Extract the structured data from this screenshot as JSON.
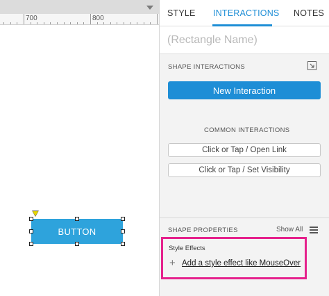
{
  "canvas": {
    "ruler": {
      "label_700": "700",
      "label_800": "800"
    },
    "shape": {
      "label": "BUTTON"
    }
  },
  "tabs": [
    {
      "label": "STYLE",
      "active": false
    },
    {
      "label": "INTERACTIONS",
      "active": true
    },
    {
      "label": "NOTES",
      "active": false
    }
  ],
  "shape_name": {
    "value": "",
    "placeholder": "(Rectangle Name)"
  },
  "shape_interactions": {
    "title": "SHAPE INTERACTIONS",
    "split_icon": "split-view-icon",
    "new_interaction_label": "New Interaction"
  },
  "common_interactions": {
    "title": "COMMON INTERACTIONS",
    "items": [
      "Click or Tap / Open Link",
      "Click or Tap / Set Visibility"
    ]
  },
  "shape_properties": {
    "title": "SHAPE PROPERTIES",
    "show_all": "Show All",
    "menu_icon": "hamburger-icon"
  },
  "style_effects": {
    "title": "Style Effects",
    "add_label": "Add a style effect like MouseOver",
    "add_icon": "plus-icon"
  },
  "colors": {
    "accent": "#1e8ed6",
    "shape_fill": "#2ea3dc",
    "highlight": "#e5218c"
  }
}
